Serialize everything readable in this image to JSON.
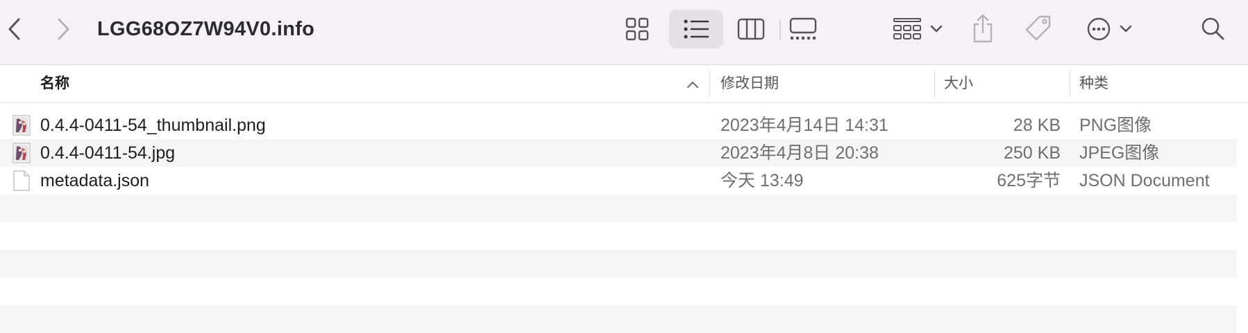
{
  "window": {
    "title": "LGG68OZ7W94V0.info"
  },
  "toolbar": {
    "back_icon": "chevron-left-icon",
    "forward_icon": "chevron-right-icon",
    "view_modes": [
      "icons-view-icon",
      "list-view-icon",
      "columns-view-icon",
      "gallery-view-icon"
    ],
    "selected_view": "list",
    "group_icon": "group-by-icon",
    "share_icon": "share-icon",
    "tag_icon": "tag-icon",
    "more_icon": "ellipsis-circle-icon",
    "search_icon": "search-icon"
  },
  "columns": {
    "name": "名称",
    "date": "修改日期",
    "size": "大小",
    "kind": "种类"
  },
  "files": [
    {
      "icon": "image-file-icon",
      "name": "0.4.4-0411-54_thumbnail.png",
      "date": "2023年4月14日 14:31",
      "size": "28 KB",
      "kind": "PNG图像"
    },
    {
      "icon": "image-file-icon",
      "name": "0.4.4-0411-54.jpg",
      "date": "2023年4月8日 20:38",
      "size": "250 KB",
      "kind": "JPEG图像"
    },
    {
      "icon": "document-file-icon",
      "name": "metadata.json",
      "date": "今天 13:49",
      "size": "625字节",
      "kind": "JSON Document"
    }
  ],
  "colors": {
    "toolbar_bg": "#f6f1f6",
    "alt_row": "#f4f5f5",
    "selected_view_bg": "#e6e0e6"
  }
}
